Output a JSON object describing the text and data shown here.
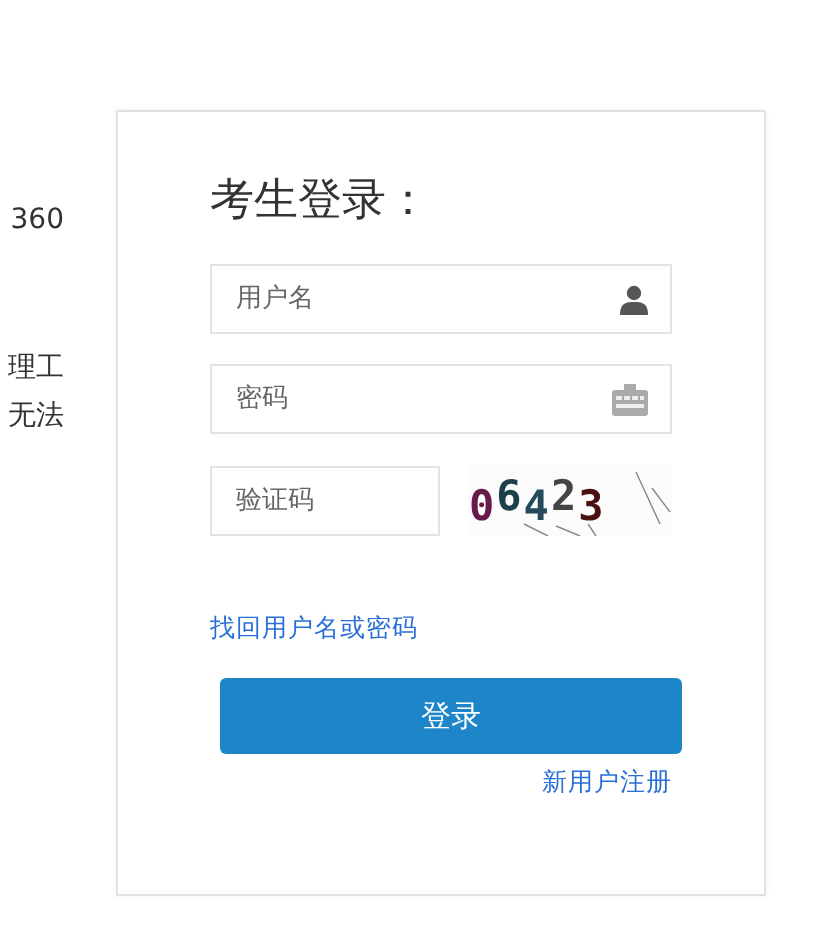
{
  "side_text": [
    "360",
    "理工",
    "无法"
  ],
  "login": {
    "title": "考生登录：",
    "fields": [
      {
        "kind": "user",
        "placeholder": "用户名"
      },
      {
        "kind": "password",
        "placeholder": "密码"
      }
    ],
    "captcha": {
      "placeholder": "验证码",
      "code": "06423"
    },
    "forgot_link": "找回用户名或密码",
    "submit": "登录",
    "register_link": "新用户注册"
  }
}
